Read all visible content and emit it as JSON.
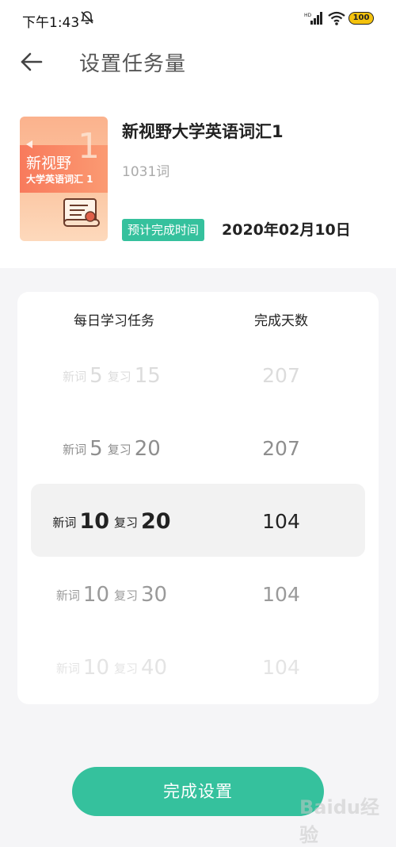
{
  "status_bar": {
    "time": "下午1:43",
    "battery": "100"
  },
  "header": {
    "title": "设置任务量"
  },
  "book": {
    "cover_title": "新视野",
    "cover_subtitle": "大学英语词汇 1",
    "cover_number": "1",
    "title": "新视野大学英语词汇1",
    "word_count": "1031词",
    "estimate_label": "预计完成时间",
    "estimate_date": "2020年02月10日"
  },
  "picker": {
    "col_task": "每日学习任务",
    "col_days": "完成天数",
    "new_label": "新词",
    "review_label": "复习",
    "rows": [
      {
        "new": "5",
        "review": "15",
        "days": "207"
      },
      {
        "new": "5",
        "review": "20",
        "days": "207"
      },
      {
        "new": "10",
        "review": "20",
        "days": "104"
      },
      {
        "new": "10",
        "review": "30",
        "days": "104"
      },
      {
        "new": "10",
        "review": "40",
        "days": "104"
      }
    ]
  },
  "actions": {
    "done_label": "完成设置"
  },
  "watermark": "Baidu经验",
  "colors": {
    "accent": "#35c19d",
    "battery": "#f4c20d"
  }
}
